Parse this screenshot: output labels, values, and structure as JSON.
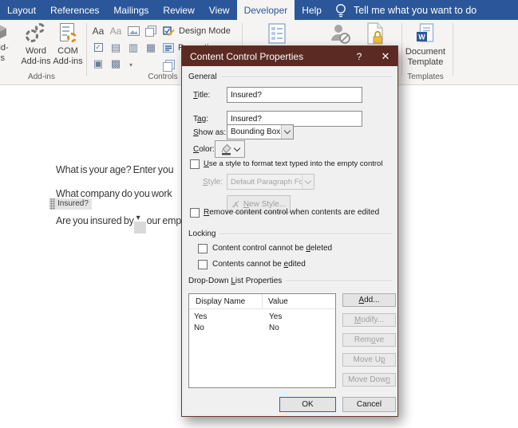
{
  "tab_bar": {
    "tabs": [
      "Layout",
      "References",
      "Mailings",
      "Review",
      "View",
      "Developer",
      "Help"
    ],
    "active_tab": "Developer",
    "tell_me": "Tell me what you want to do"
  },
  "ribbon": {
    "addins_cut_button": "Add-\nins",
    "word_addins": "Word Add-ins",
    "com_addins": "COM Add-ins",
    "addins_group": "Add-ins",
    "rich_text_glyph": "Aa",
    "plain_text_glyph": "Aa",
    "design_mode": "Design Mode",
    "properties": "Properties",
    "controls_group": "Controls",
    "document_template": "Document Template",
    "templates_group": "Templates"
  },
  "document": {
    "line1": "What is your age? Enter you",
    "line2": "What company do you work",
    "content_control_tag": "Insured?",
    "line3_start": "Are you insured by",
    "line3_end": "our emp"
  },
  "dialog": {
    "title": "Content Control Properties",
    "help_label": "?",
    "close_label": "✕",
    "sections": {
      "general": "General",
      "locking": "Locking",
      "ddl": "Drop-Down List Properties"
    },
    "fields": {
      "title_label": "Title:",
      "title_value": "Insured?",
      "tag_label": "Tag:",
      "tag_value": "Insured?",
      "show_as_label": "Show as:",
      "show_as_value": "Bounding Box",
      "color_label": "Color:",
      "use_style": "Use a style to format text typed into the empty control",
      "style_label": "Style:",
      "style_value": "Default Paragraph Font",
      "new_style": "New Style...",
      "remove_when_edited": "Remove content control when contents are edited",
      "cannot_delete": "Content control cannot be deleted",
      "cannot_edit": "Contents cannot be edited"
    },
    "states": {
      "use_style_checked": false,
      "remove_when_edited_checked": false,
      "cannot_delete_checked": false,
      "cannot_edit_checked": false
    },
    "list": {
      "col_display": "Display Name",
      "col_value": "Value",
      "rows": [
        {
          "display": "Yes",
          "value": "Yes"
        },
        {
          "display": "No",
          "value": "No"
        }
      ]
    },
    "buttons": {
      "add": "Add...",
      "modify": "Modify...",
      "remove": "Remove",
      "move_up": "Move Up",
      "move_down": "Move Down",
      "ok": "OK",
      "cancel": "Cancel"
    }
  },
  "colors": {
    "tab_bar": "#2b579a",
    "dialog_titlebar": "#5b2a22",
    "default_button_border": "#0f6cbd",
    "ribbon_background": "#f5f4f2"
  }
}
